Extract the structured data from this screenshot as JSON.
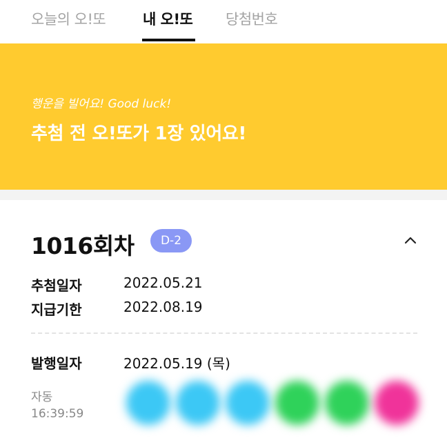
{
  "tabs": [
    {
      "label": "오늘의 오!또",
      "active": false
    },
    {
      "label": "내 오!또",
      "active": true
    },
    {
      "label": "당첨번호",
      "active": false
    }
  ],
  "banner": {
    "subtitle": "행운을 빌어요! Good luck!",
    "title": "추첨 전 오!또가 1장 있어요!",
    "color": "#ffcb2f"
  },
  "ticket": {
    "round": "1016회차",
    "dday_badge": "D-2",
    "collapse_icon": "chevron-up-icon",
    "draw_date_label": "추첨일자",
    "draw_date": "2022.05.21",
    "claim_deadline_label": "지급기한",
    "claim_deadline": "2022.08.19",
    "issue_date_label": "발행일자",
    "issue_date": "2022.05.19 (목)",
    "mode": "자동",
    "time": "16:39:59",
    "ball_colors": [
      "#3cc8f5",
      "#3cc8f5",
      "#3cc8f5",
      "#2fd25a",
      "#2fd25a",
      "#f0339a"
    ]
  }
}
